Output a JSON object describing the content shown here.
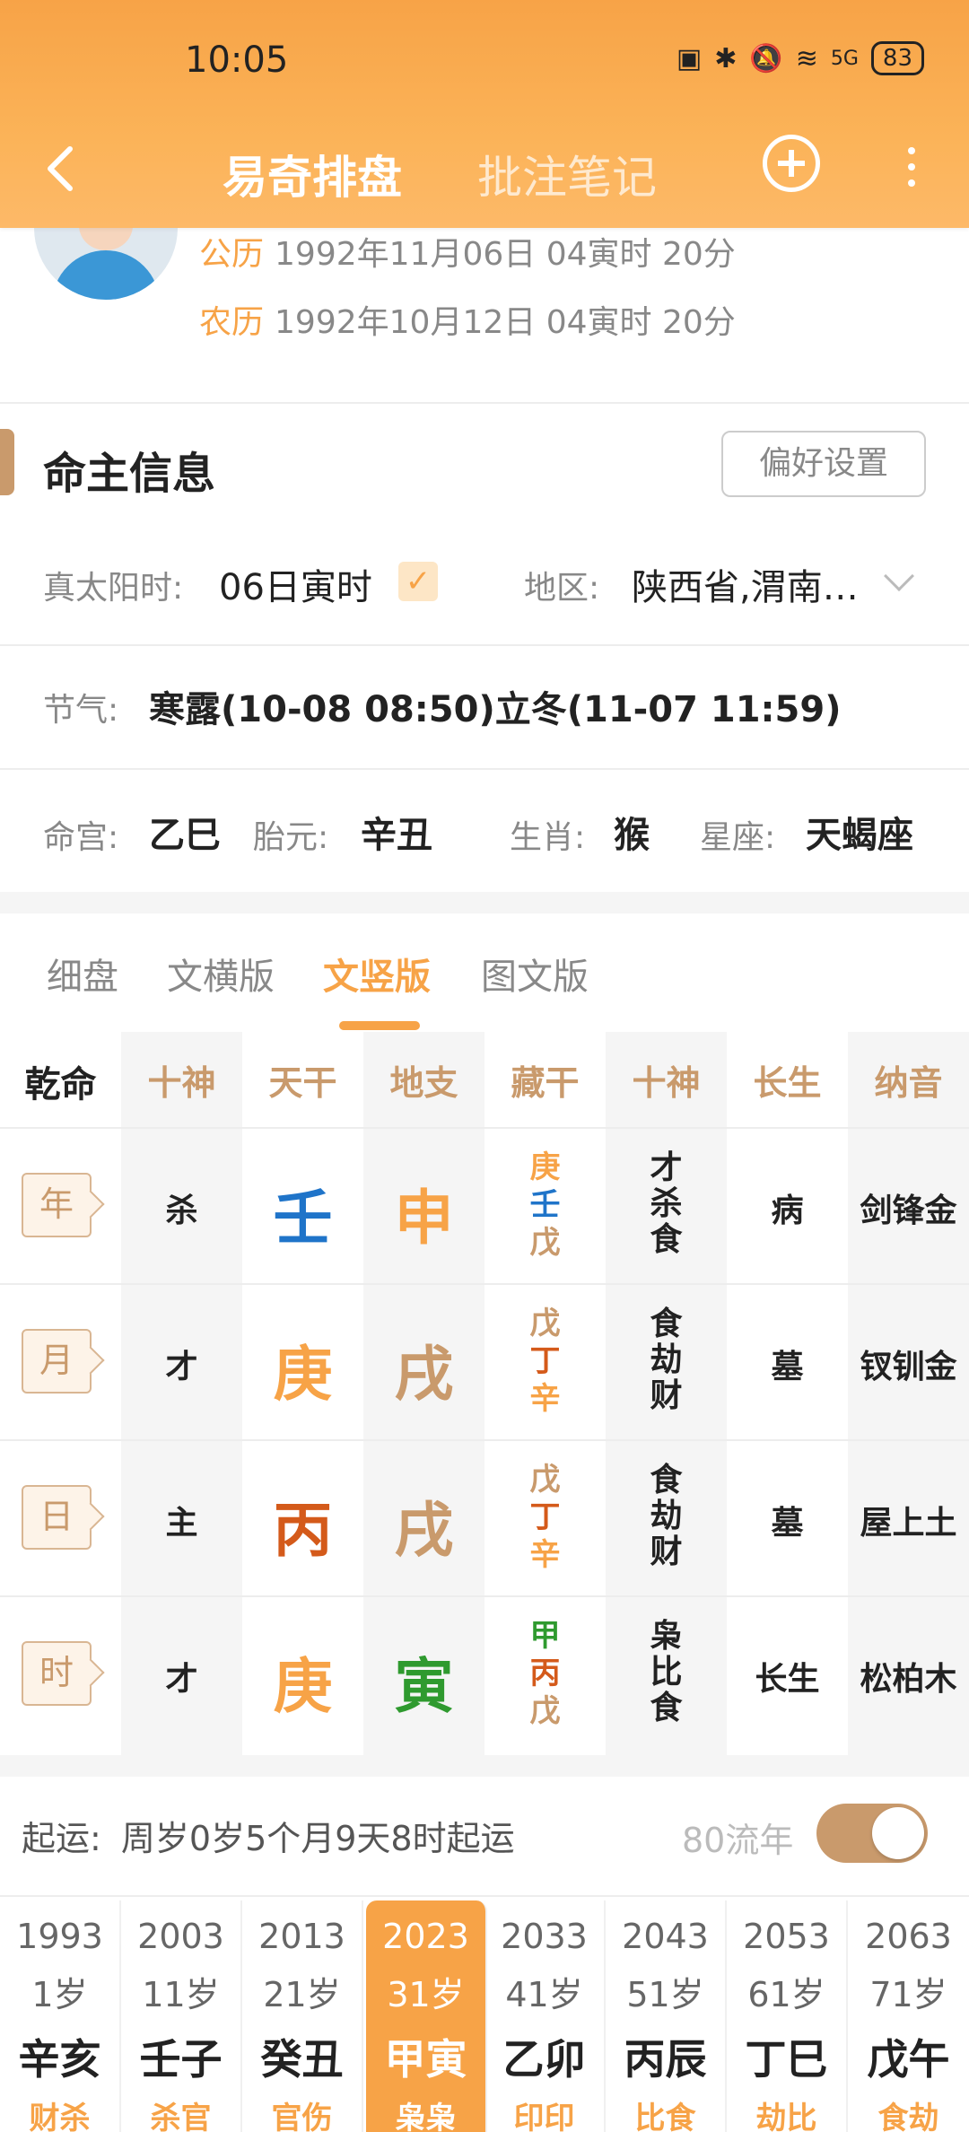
{
  "status": {
    "time": "10:05",
    "battery": "83",
    "network": "5G"
  },
  "nav": {
    "title": "易奇排盘",
    "tab2": "批注笔记"
  },
  "profile": {
    "solar_tag": "公历",
    "solar_date": "1992年11月06日 04寅时 20分",
    "lunar_tag": "农历",
    "lunar_date": "1992年10月12日 04寅时 20分"
  },
  "info": {
    "title": "命主信息",
    "pref_button": "偏好设置",
    "true_solar_label": "真太阳时:",
    "true_solar_value": "06日寅时",
    "region_label": "地区:",
    "region_value": "陕西省,渭南…",
    "jieqi_label": "节气:",
    "jieqi_value": "寒露(10-08 08:50)立冬(11-07 11:59)",
    "minggong_label": "命宫:",
    "minggong_value": "乙巳",
    "taiyuan_label": "胎元:",
    "taiyuan_value": "辛丑",
    "shengxiao_label": "生肖:",
    "shengxiao_value": "猴",
    "xingzuo_label": "星座:",
    "xingzuo_value": "天蝎座"
  },
  "tabs": [
    "细盘",
    "文横版",
    "文竖版",
    "图文版"
  ],
  "grid": {
    "headers": [
      "乾命",
      "十神",
      "天干",
      "地支",
      "藏干",
      "十神",
      "长生",
      "纳音"
    ],
    "rows": [
      {
        "pillar": "年",
        "god": "杀",
        "stem": "壬",
        "branch": "申",
        "hidden": [
          "庚",
          "壬",
          "戊"
        ],
        "gods": [
          "才",
          "杀",
          "食"
        ],
        "cs": "病",
        "nayin": "剑锋金"
      },
      {
        "pillar": "月",
        "god": "才",
        "stem": "庚",
        "branch": "戌",
        "hidden": [
          "戊",
          "丁",
          "辛"
        ],
        "gods": [
          "食",
          "劫",
          "财"
        ],
        "cs": "墓",
        "nayin": "钗钏金"
      },
      {
        "pillar": "日",
        "god": "主",
        "stem": "丙",
        "branch": "戌",
        "hidden": [
          "戊",
          "丁",
          "辛"
        ],
        "gods": [
          "食",
          "劫",
          "财"
        ],
        "cs": "墓",
        "nayin": "屋上土"
      },
      {
        "pillar": "时",
        "god": "才",
        "stem": "庚",
        "branch": "寅",
        "hidden": [
          "甲",
          "丙",
          "戊"
        ],
        "gods": [
          "枭",
          "比",
          "食"
        ],
        "cs": "长生",
        "nayin": "松柏木"
      }
    ]
  },
  "qiyun": {
    "label": "起运:",
    "text": "周岁0岁5个月9天8时起运",
    "liunian": "80流年"
  },
  "dayun": [
    {
      "year": "1993",
      "age": "1岁",
      "gz": "辛亥",
      "ss": "财杀"
    },
    {
      "year": "2003",
      "age": "11岁",
      "gz": "壬子",
      "ss": "杀官"
    },
    {
      "year": "2013",
      "age": "21岁",
      "gz": "癸丑",
      "ss": "官伤"
    },
    {
      "year": "2023",
      "age": "31岁",
      "gz": "甲寅",
      "ss": "枭枭"
    },
    {
      "year": "2033",
      "age": "41岁",
      "gz": "乙卯",
      "ss": "印印"
    },
    {
      "year": "2043",
      "age": "51岁",
      "gz": "丙辰",
      "ss": "比食"
    },
    {
      "year": "2053",
      "age": "61岁",
      "gz": "丁巳",
      "ss": "劫比"
    },
    {
      "year": "2063",
      "age": "71岁",
      "gz": "戊午",
      "ss": "食劫"
    }
  ],
  "colors": {
    "accent": "#f7a347",
    "tan": "#c99a6c",
    "blue": "#1f74c9",
    "red": "#d45a1a",
    "green": "#2f9a2f"
  }
}
